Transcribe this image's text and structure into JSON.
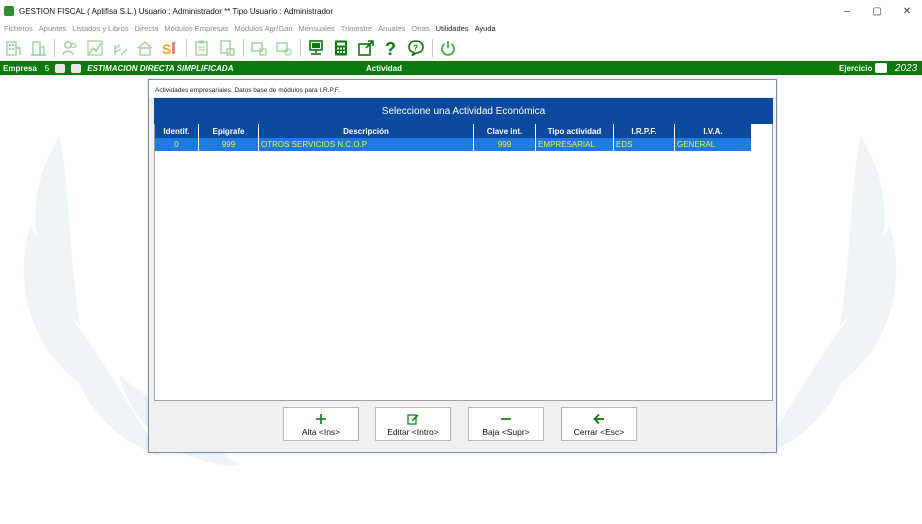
{
  "window": {
    "title": "GESTION FISCAL  ( Aplifisa S.L.)  Usuario : Administrador  **  Tipo Usuario : Administrador",
    "minimize": "–",
    "maximize": "▢",
    "close": "✕"
  },
  "menu": {
    "items": [
      {
        "label": "Ficheros"
      },
      {
        "label": "Apuntes"
      },
      {
        "label": "Listados y Libros"
      },
      {
        "label": "Directa"
      },
      {
        "label": "Módulos Empresas"
      },
      {
        "label": "Módulos Agr/Gan"
      },
      {
        "label": "Mensuales"
      },
      {
        "label": "Trimestre"
      },
      {
        "label": "Anuales"
      },
      {
        "label": "Otras"
      },
      {
        "label": "Utilidades"
      },
      {
        "label": "Ayuda"
      }
    ]
  },
  "company_bar": {
    "empresa_label": "Empresa",
    "empresa_number": "5",
    "regime": "ESTIMACION DIRECTA SIMPLIFICADA",
    "actividad_label": "Actividad",
    "ejercicio_label": "Ejercicio",
    "year": "2023"
  },
  "dialog": {
    "title": "Actividades empresariales. Datos base de módulos para I.R.P.F.",
    "header": "Seleccione una Actividad Económica",
    "columns": {
      "identif": "Identif.",
      "epigrafe": "Epigrafe",
      "descripcion": "Descripción",
      "clave": "Clave int.",
      "tipo": "Tipo actividad",
      "irpf": "I.R.P.F.",
      "iva": "I.V.A."
    },
    "rows": [
      {
        "identif": "0",
        "epigrafe": "999",
        "descripcion": "OTROS SERVICIOS N.C.O.P",
        "clave": "999",
        "tipo": "EMPRESARIAL",
        "irpf": "EDS",
        "iva": "GENERAL"
      }
    ],
    "buttons": {
      "alta": "Alta <Ins>",
      "editar": "Editar <Intro>",
      "baja": "Baja <Supr>",
      "cerrar": "Cerrar <Esc>"
    }
  },
  "colors": {
    "brand_green": "#0a7a0a",
    "header_blue": "#0a4a9e",
    "selection_blue": "#1e7be0",
    "selection_text": "#e8f04a"
  }
}
